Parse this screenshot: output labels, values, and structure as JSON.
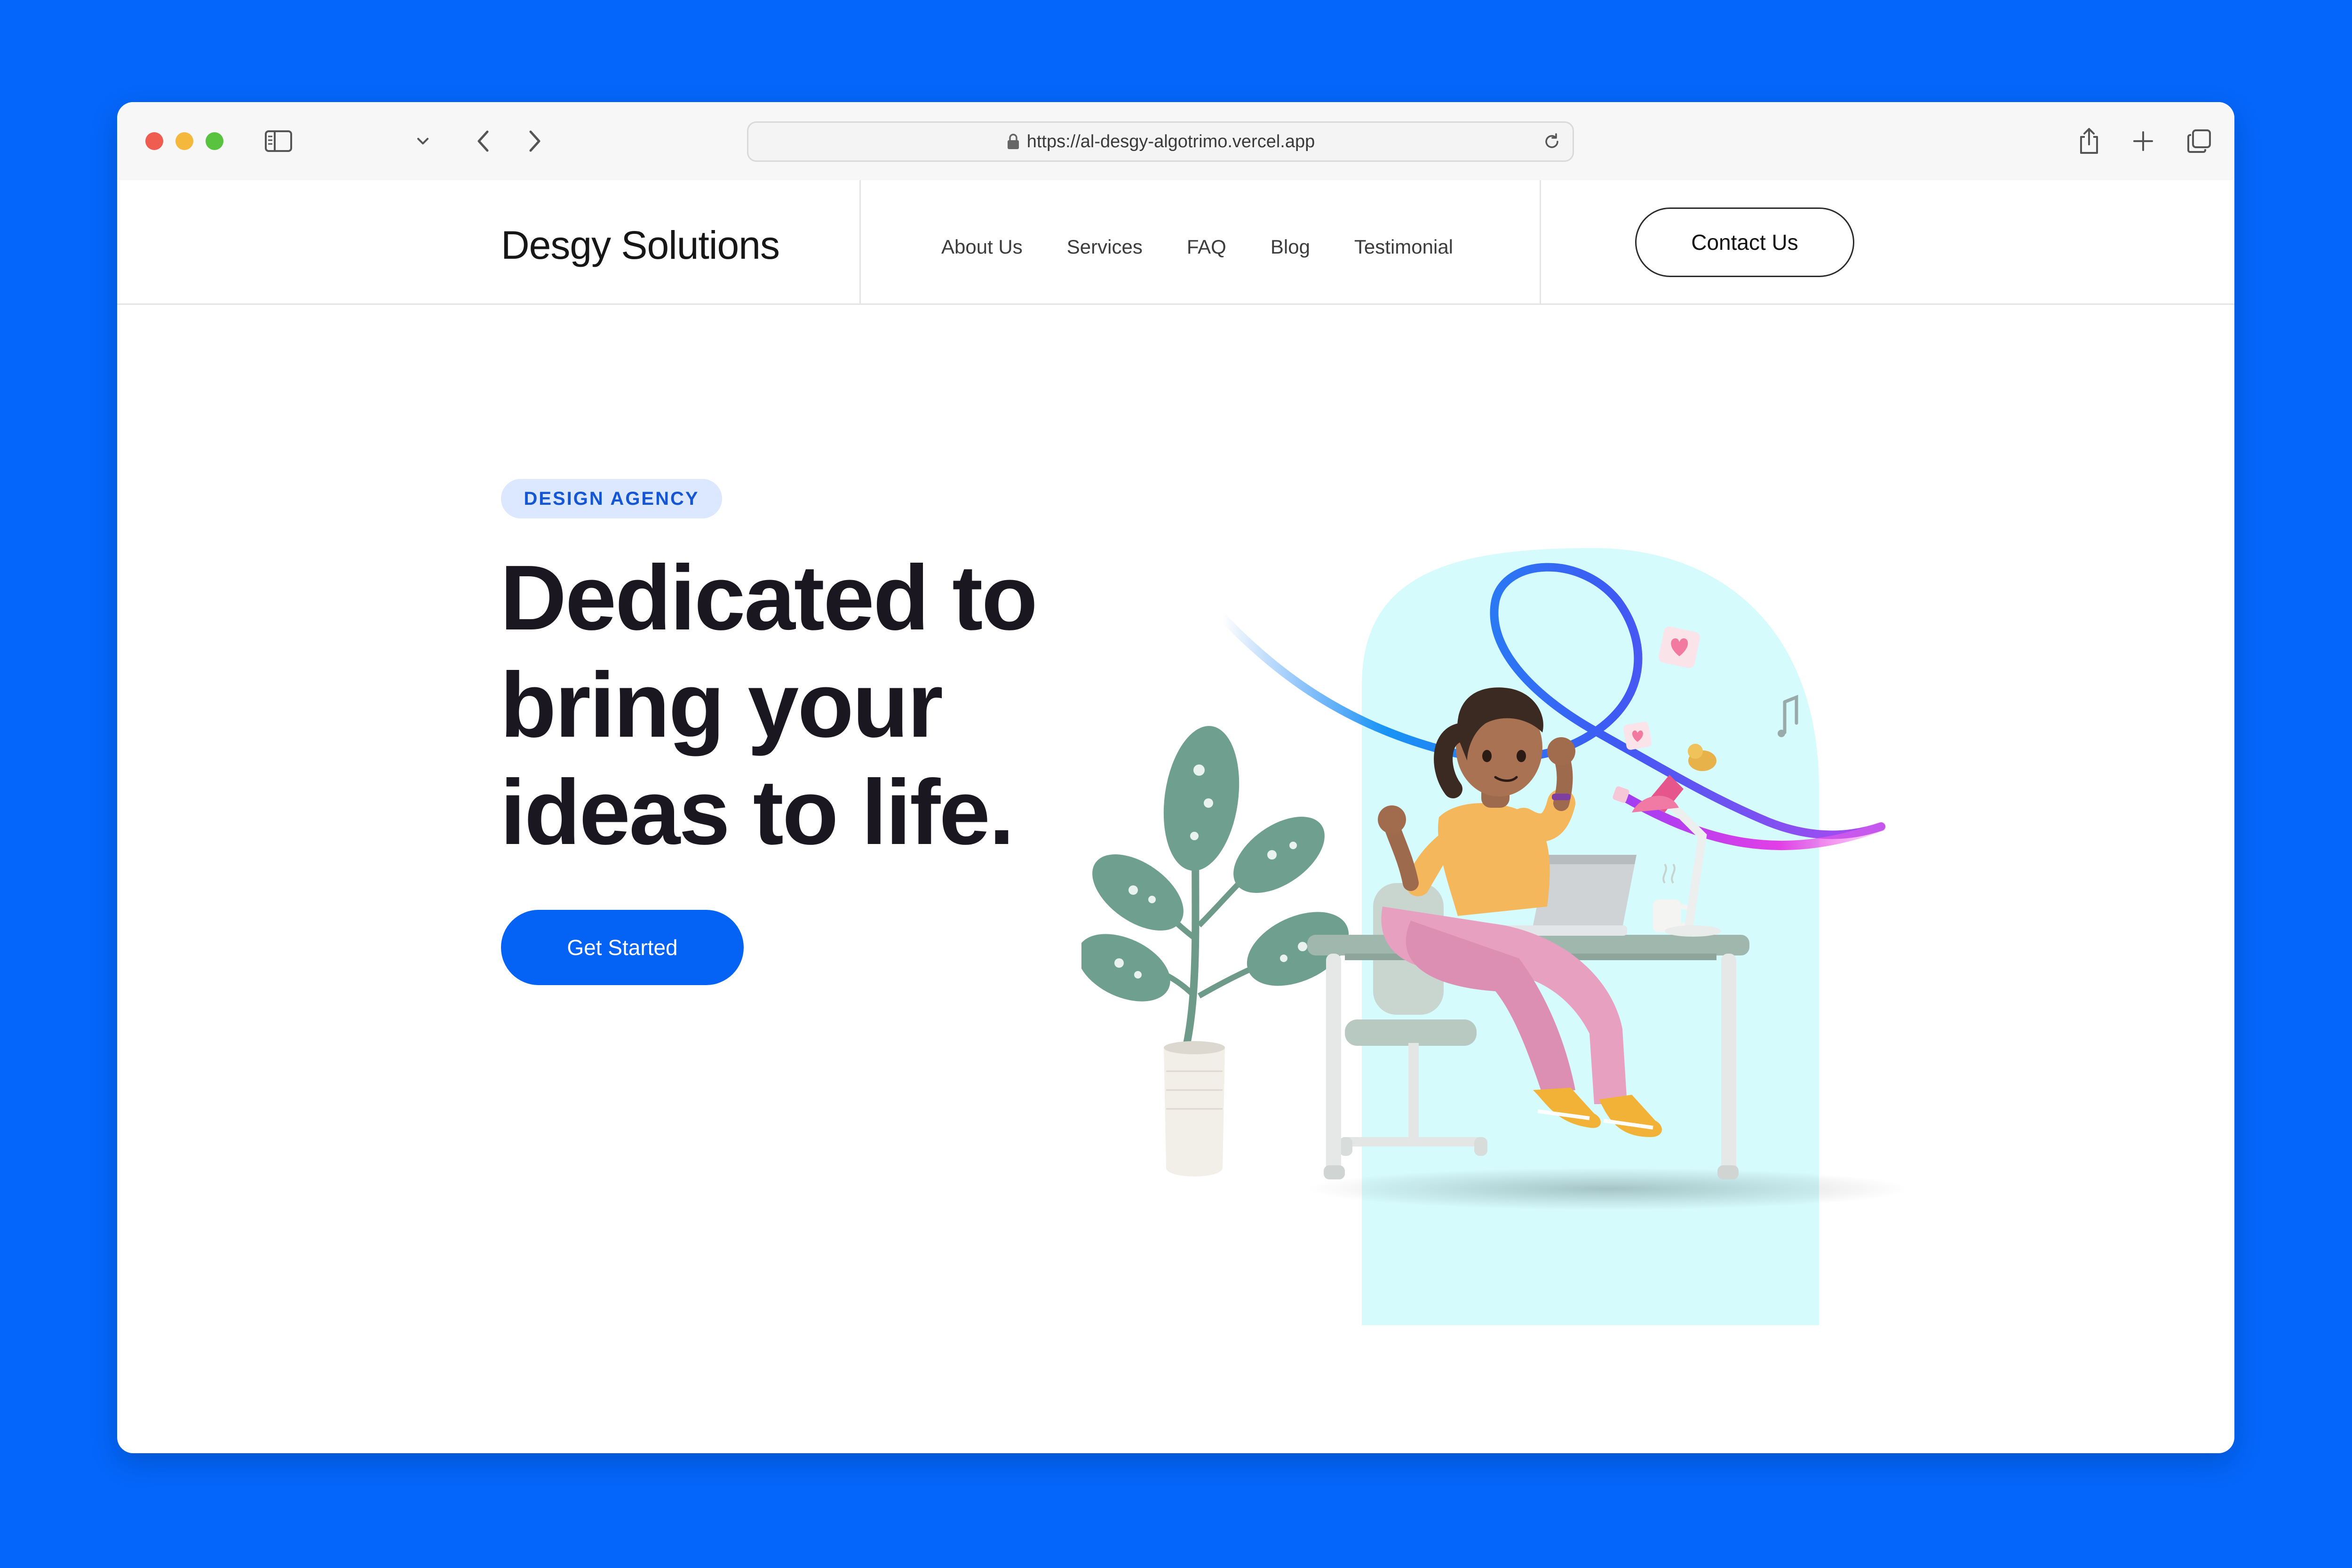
{
  "browser": {
    "url": "https://al-desgy-algotrimo.vercel.app",
    "traffic_lights": {
      "close": "#ee5d50",
      "minimize": "#f4b93c",
      "maximize": "#59c23f"
    }
  },
  "site": {
    "brand": "Desgy Solutions",
    "nav": [
      {
        "label": "About Us"
      },
      {
        "label": "Services"
      },
      {
        "label": "FAQ"
      },
      {
        "label": "Blog"
      },
      {
        "label": "Testimonial"
      }
    ],
    "contact_label": "Contact Us"
  },
  "hero": {
    "badge": "DESIGN AGENCY",
    "title_lines": [
      "Dedicated to",
      "bring your",
      "ideas to life."
    ],
    "cta_label": "Get Started"
  },
  "colors": {
    "page_background": "#0466fb",
    "accent": "#0462f5",
    "badge_bg": "#dce8ff",
    "badge_text": "#1556d4",
    "illustration_bg": "#d5fbfd"
  }
}
